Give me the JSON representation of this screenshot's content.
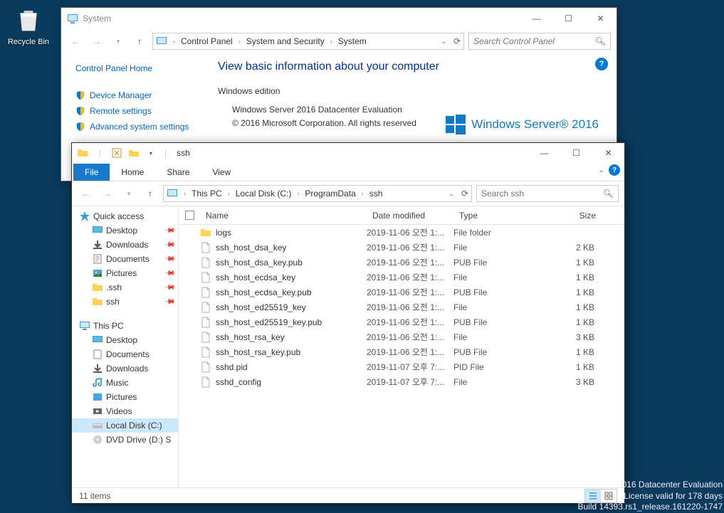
{
  "desktop": {
    "recycle_bin": "Recycle Bin"
  },
  "system_window": {
    "title": "System",
    "breadcrumbs": [
      "Control Panel",
      "System and Security",
      "System"
    ],
    "search_placeholder": "Search Control Panel",
    "sidebar": {
      "home": "Control Panel Home",
      "links": [
        "Device Manager",
        "Remote settings",
        "Advanced system settings"
      ]
    },
    "heading": "View basic information about your computer",
    "section": "Windows edition",
    "edition": "Windows Server 2016 Datacenter Evaluation",
    "copyright": "© 2016 Microsoft Corporation. All rights reserved",
    "os_brand": "Windows Server® 2016"
  },
  "explorer_window": {
    "title": "ssh",
    "tabs": {
      "file": "File",
      "home": "Home",
      "share": "Share",
      "view": "View"
    },
    "breadcrumbs": [
      "This PC",
      "Local Disk (C:)",
      "ProgramData",
      "ssh"
    ],
    "search_placeholder": "Search ssh",
    "nav_tree": {
      "quick_access": "Quick access",
      "qa_items": [
        "Desktop",
        "Downloads",
        "Documents",
        "Pictures",
        ".ssh",
        "ssh"
      ],
      "this_pc": "This PC",
      "pc_items": [
        "Desktop",
        "Documents",
        "Downloads",
        "Music",
        "Pictures",
        "Videos",
        "Local Disk (C:)",
        "DVD Drive (D:) S"
      ]
    },
    "columns": {
      "name": "Name",
      "date": "Date modified",
      "type": "Type",
      "size": "Size"
    },
    "files": [
      {
        "name": "logs",
        "date": "2019-11-06 오전 1:...",
        "type": "File folder",
        "size": "",
        "icon": "folder"
      },
      {
        "name": "ssh_host_dsa_key",
        "date": "2019-11-06 오전 1:...",
        "type": "File",
        "size": "2 KB",
        "icon": "file"
      },
      {
        "name": "ssh_host_dsa_key.pub",
        "date": "2019-11-06 오전 1:...",
        "type": "PUB File",
        "size": "1 KB",
        "icon": "file"
      },
      {
        "name": "ssh_host_ecdsa_key",
        "date": "2019-11-06 오전 1:...",
        "type": "File",
        "size": "1 KB",
        "icon": "file"
      },
      {
        "name": "ssh_host_ecdsa_key.pub",
        "date": "2019-11-06 오전 1:...",
        "type": "PUB File",
        "size": "1 KB",
        "icon": "file"
      },
      {
        "name": "ssh_host_ed25519_key",
        "date": "2019-11-06 오전 1:...",
        "type": "File",
        "size": "1 KB",
        "icon": "file"
      },
      {
        "name": "ssh_host_ed25519_key.pub",
        "date": "2019-11-06 오전 1:...",
        "type": "PUB File",
        "size": "1 KB",
        "icon": "file"
      },
      {
        "name": "ssh_host_rsa_key",
        "date": "2019-11-06 오전 1:...",
        "type": "File",
        "size": "3 KB",
        "icon": "file"
      },
      {
        "name": "ssh_host_rsa_key.pub",
        "date": "2019-11-06 오전 1:...",
        "type": "PUB File",
        "size": "1 KB",
        "icon": "file"
      },
      {
        "name": "sshd.pid",
        "date": "2019-11-07 오후 7:...",
        "type": "PID File",
        "size": "1 KB",
        "icon": "file"
      },
      {
        "name": "sshd_config",
        "date": "2019-11-07 오후 7:...",
        "type": "File",
        "size": "3 KB",
        "icon": "file"
      }
    ],
    "status": "11 items"
  },
  "watermark": {
    "l1": "016 Datacenter Evaluation",
    "l2": "License valid for 178 days",
    "l3": "Build 14393.rs1_release.161220-1747"
  }
}
